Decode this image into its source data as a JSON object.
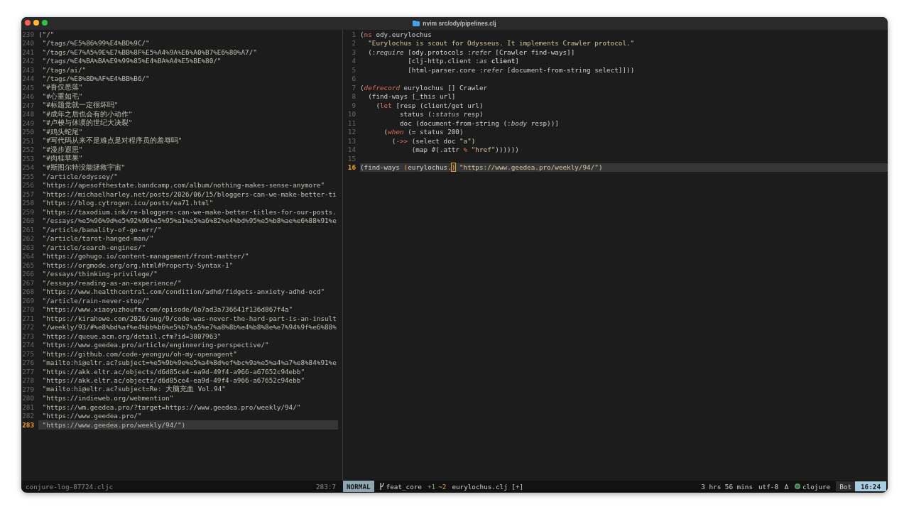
{
  "window": {
    "title": "nvim src/ody/pipelines.clj"
  },
  "log_pane": {
    "lines": [
      {
        "number": "239",
        "text": "(\"/\"",
        "current": false
      },
      {
        "number": "240",
        "text": " \"/tags/%E5%86%99%E4%BD%9C/\"",
        "current": false
      },
      {
        "number": "241",
        "text": " \"/tags/%E7%A5%9E%E7%BB%8F%E5%A4%9A%E6%A0%B7%E6%80%A7/\"",
        "current": false
      },
      {
        "number": "242",
        "text": " \"/tags/%E4%BA%BA%E9%99%85%E4%BA%A4%E5%BE%80/\"",
        "current": false
      },
      {
        "number": "243",
        "text": " \"/tags/ai/\"",
        "current": false
      },
      {
        "number": "244",
        "text": " \"/tags/%E8%BD%AF%E4%BB%B6/\"",
        "current": false
      },
      {
        "number": "245",
        "text": " \"#吾仅悉落\"",
        "current": false
      },
      {
        "number": "246",
        "text": " \"#心重如毛\"",
        "current": false
      },
      {
        "number": "247",
        "text": " \"#标题党就一定很坏吗\"",
        "current": false
      },
      {
        "number": "248",
        "text": " \"#成年之后也会有的小动作\"",
        "current": false
      },
      {
        "number": "249",
        "text": " \"#卢梭与休谟的世纪大决裂\"",
        "current": false
      },
      {
        "number": "250",
        "text": " \"#鸡头蛇尾\"",
        "current": false
      },
      {
        "number": "251",
        "text": " \"#写代码从来不是难点是对程序员的羞辱吗\"",
        "current": false
      },
      {
        "number": "252",
        "text": " \"#漫步遐思\"",
        "current": false
      },
      {
        "number": "253",
        "text": " \"#肉桂苹果\"",
        "current": false
      },
      {
        "number": "254",
        "text": " \"#斯图尔特没能拯救宇宙\"",
        "current": false
      },
      {
        "number": "255",
        "text": " \"/article/odyssey/\"",
        "current": false
      },
      {
        "number": "256",
        "text": " \"https://apesofthestate.bandcamp.com/album/nothing-makes-sense-anymore\"",
        "current": false
      },
      {
        "number": "257",
        "text": " \"https://michaelharley.net/posts/2026/06/15/bloggers-can-we-make-better-ti",
        "current": false
      },
      {
        "number": "258",
        "text": " \"https://blog.cytrogen.icu/posts/ea71.html\"",
        "current": false
      },
      {
        "number": "259",
        "text": " \"https://taxodium.ink/re-bloggers-can-we-make-better-titles-for-our-posts.",
        "current": false
      },
      {
        "number": "260",
        "text": " \"/essays/%e5%96%9d%e5%92%96%e5%95%a1%e5%a6%82%e4%bd%95%e5%b8%ae%e6%88%91%e",
        "current": false
      },
      {
        "number": "261",
        "text": " \"/article/banality-of-go-err/\"",
        "current": false
      },
      {
        "number": "262",
        "text": " \"/article/tarot-hanged-man/\"",
        "current": false
      },
      {
        "number": "263",
        "text": " \"/article/search-engines/\"",
        "current": false
      },
      {
        "number": "264",
        "text": " \"https://gohugo.io/content-management/front-matter/\"",
        "current": false
      },
      {
        "number": "265",
        "text": " \"https://orgmode.org/org.html#Property-Syntax-1\"",
        "current": false
      },
      {
        "number": "266",
        "text": " \"/essays/thinking-privilege/\"",
        "current": false
      },
      {
        "number": "267",
        "text": " \"/essays/reading-as-an-experience/\"",
        "current": false
      },
      {
        "number": "268",
        "text": " \"https://www.healthcentral.com/condition/adhd/fidgets-anxiety-adhd-ocd\"",
        "current": false
      },
      {
        "number": "269",
        "text": " \"/article/rain-never-stop/\"",
        "current": false
      },
      {
        "number": "270",
        "text": " \"https://www.xiaoyuzhoufm.com/episode/6a7ad3a736641f136d867f4a\"",
        "current": false
      },
      {
        "number": "271",
        "text": " \"https://kirahowe.com/2026/aug/9/code-was-never-the-hard-part-is-an-insult",
        "current": false
      },
      {
        "number": "272",
        "text": " \"/weekly/93/#%e8%bd%af%e4%bb%b6%e5%b7%a5%e7%a8%8b%e4%b8%8e%e7%94%9f%e6%88%",
        "current": false
      },
      {
        "number": "273",
        "text": " \"https://queue.acm.org/detail.cfm?id=3807963\"",
        "current": false
      },
      {
        "number": "274",
        "text": " \"https://www.geedea.pro/article/engineering-perspective/\"",
        "current": false
      },
      {
        "number": "275",
        "text": " \"https://github.com/code-yeongyu/oh-my-openagent\"",
        "current": false
      },
      {
        "number": "276",
        "text": " \"mailto:hi@eltr.ac?subject=%e5%9b%9e%e5%a4%8d%ef%bc%9a%e5%a4%a7%e8%84%91%e",
        "current": false
      },
      {
        "number": "277",
        "text": " \"https://akk.eltr.ac/objects/d6d85ce4-ea9d-49f4-a966-a67652c94ebb\"",
        "current": false
      },
      {
        "number": "278",
        "text": " \"https://akk.eltr.ac/objects/d6d85ce4-ea9d-49f4-a966-a67652c94ebb\"",
        "current": false
      },
      {
        "number": "279",
        "text": " \"mailto:hi@eltr.ac?subject=Re: 大脑充血 Vol.94\"",
        "current": false
      },
      {
        "number": "280",
        "text": " \"https://indieweb.org/webmention\"",
        "current": false
      },
      {
        "number": "281",
        "text": " \"https://wm.geedea.pro/?target=https://www.geedea.pro/weekly/94/\"",
        "current": false
      },
      {
        "number": "282",
        "text": " \"https://www.geedea.pro/\"",
        "current": false
      },
      {
        "number": "283",
        "text": " \"https://www.geedea.pro/weekly/94/\")",
        "current": true
      }
    ]
  },
  "code_pane": {
    "lines": [
      {
        "number": "1",
        "current": false,
        "segments": [
          {
            "kind": "plain",
            "text": "("
          },
          {
            "kind": "keyword",
            "text": "ns"
          },
          {
            "kind": "plain",
            "text": " ody.eurylochus"
          }
        ]
      },
      {
        "number": "2",
        "current": false,
        "segments": [
          {
            "kind": "string",
            "text": "  \"Eurylochus is scout for Odysseus. It implements Crawler protocol.\""
          }
        ]
      },
      {
        "number": "3",
        "current": false,
        "segments": [
          {
            "kind": "plain",
            "text": "  (:"
          },
          {
            "kind": "italic",
            "text": "require"
          },
          {
            "kind": "plain",
            "text": " [ody.protocols :"
          },
          {
            "kind": "italic",
            "text": "refer"
          },
          {
            "kind": "plain",
            "text": " [Crawler find-ways]]"
          }
        ]
      },
      {
        "number": "4",
        "current": false,
        "segments": [
          {
            "kind": "plain",
            "text": "            [clj-http.client :"
          },
          {
            "kind": "italic",
            "text": "as"
          },
          {
            "kind": "bright",
            "text": " client"
          },
          {
            "kind": "plain",
            "text": "]"
          }
        ]
      },
      {
        "number": "5",
        "current": false,
        "segments": [
          {
            "kind": "plain",
            "text": "            [html-parser.core :"
          },
          {
            "kind": "italic",
            "text": "refer"
          },
          {
            "kind": "plain",
            "text": " [document-from-string select]]))"
          }
        ]
      },
      {
        "number": "6",
        "current": false
      },
      {
        "number": "7",
        "current": false,
        "segments": [
          {
            "kind": "plain",
            "text": "("
          },
          {
            "kind": "special",
            "text": "defrecord"
          },
          {
            "kind": "plain",
            "text": " eurylochus [] Crawler"
          }
        ]
      },
      {
        "number": "8",
        "current": false,
        "segments": [
          {
            "kind": "plain",
            "text": "  (find-ways [_this url]"
          }
        ]
      },
      {
        "number": "9",
        "current": false,
        "segments": [
          {
            "kind": "plain",
            "text": "    ("
          },
          {
            "kind": "keyword",
            "text": "let"
          },
          {
            "kind": "plain",
            "text": " [resp (client/get url)"
          }
        ]
      },
      {
        "number": "10",
        "current": false,
        "segments": [
          {
            "kind": "plain",
            "text": "          status (:"
          },
          {
            "kind": "italic",
            "text": "status"
          },
          {
            "kind": "plain",
            "text": " resp)"
          }
        ]
      },
      {
        "number": "11",
        "current": false,
        "segments": [
          {
            "kind": "plain",
            "text": "          doc (document-from-string (:"
          },
          {
            "kind": "italic",
            "text": "body"
          },
          {
            "kind": "plain",
            "text": " resp))]"
          }
        ]
      },
      {
        "number": "12",
        "current": false,
        "segments": [
          {
            "kind": "plain",
            "text": "      ("
          },
          {
            "kind": "special",
            "text": "when"
          },
          {
            "kind": "plain",
            "text": " (= status 200)"
          }
        ]
      },
      {
        "number": "13",
        "current": false,
        "segments": [
          {
            "kind": "plain",
            "text": "        ("
          },
          {
            "kind": "keyword",
            "text": "->>"
          },
          {
            "kind": "plain",
            "text": " (select doc "
          },
          {
            "kind": "string",
            "text": "\"a\""
          },
          {
            "kind": "plain",
            "text": ")"
          }
        ]
      },
      {
        "number": "14",
        "current": false,
        "segments": [
          {
            "kind": "plain",
            "text": "             (map #(.attr "
          },
          {
            "kind": "keyword",
            "text": "%"
          },
          {
            "kind": "string",
            "text": " \"href\""
          },
          {
            "kind": "plain",
            "text": "))))))"
          }
        ]
      },
      {
        "number": "15",
        "current": false
      },
      {
        "number": "16",
        "current": true,
        "segments": [
          {
            "kind": "plain",
            "text": "(find-ways "
          },
          {
            "kind": "match",
            "text": "("
          },
          {
            "kind": "plain",
            "text": "eurylochus."
          },
          {
            "kind": "cursor",
            "text": ")"
          },
          {
            "kind": "string",
            "text": " \"https://www.geedea.pro/weekly/94/\""
          },
          {
            "kind": "plain",
            "text": ")"
          }
        ]
      }
    ]
  },
  "status_bar": {
    "log_file": "conjure-log-87724.cljc",
    "position": "283:7",
    "mode": "NORMAL",
    "branch": "feat_core",
    "added": "+1",
    "changed": "~2",
    "file": "eurylochus.clj [+]",
    "elapsed": "3 hrs 56 mins",
    "encoding": "utf-8",
    "filetype": "clojure",
    "scroll": "Bot",
    "clock": "16:24"
  }
}
